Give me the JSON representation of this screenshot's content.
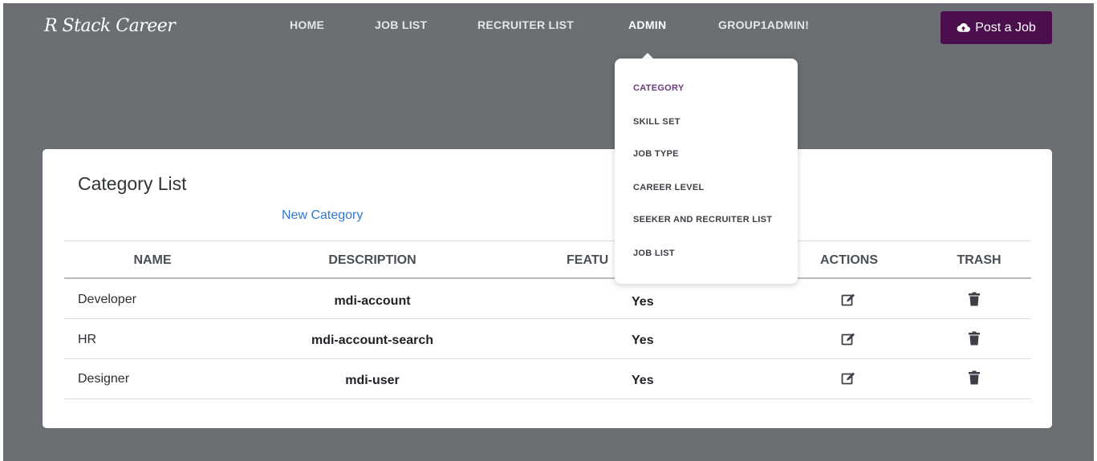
{
  "brand": {
    "logo_text": "R Stack Career"
  },
  "nav": {
    "items": [
      {
        "label": "HOME"
      },
      {
        "label": "JOB LIST"
      },
      {
        "label": "RECRUITER LIST"
      },
      {
        "label": "ADMIN",
        "active": true
      },
      {
        "label": "GROUP1ADMIN!"
      }
    ],
    "post_button": {
      "label": "Post a Job",
      "icon": "cloud-upload-icon"
    }
  },
  "admin_menu": {
    "items": [
      {
        "label": "CATEGORY",
        "active": true
      },
      {
        "label": "SKILL SET"
      },
      {
        "label": "JOB TYPE"
      },
      {
        "label": "CAREER LEVEL"
      },
      {
        "label": "SEEKER AND RECRUITER LIST"
      },
      {
        "label": "JOB LIST"
      }
    ]
  },
  "page": {
    "title": "Category List",
    "new_link": "New Category"
  },
  "table": {
    "columns": [
      "NAME",
      "DESCRIPTION",
      "FEATU",
      "ACTIONS",
      "TRASH"
    ],
    "rows": [
      {
        "name": "Developer",
        "description": "mdi-account",
        "featured": "Yes",
        "action_icon": "edit-icon",
        "trash_icon": "trash-icon"
      },
      {
        "name": "HR",
        "description": "mdi-account-search",
        "featured": "Yes",
        "action_icon": "edit-icon",
        "trash_icon": "trash-icon"
      },
      {
        "name": "Designer",
        "description": "mdi-user",
        "featured": "Yes",
        "action_icon": "edit-icon",
        "trash_icon": "trash-icon"
      }
    ]
  },
  "colors": {
    "header_bg": "#6b6e73",
    "post_button_bg": "#4b0f4d",
    "link": "#2f78d6",
    "menu_active": "#6b3a78"
  }
}
